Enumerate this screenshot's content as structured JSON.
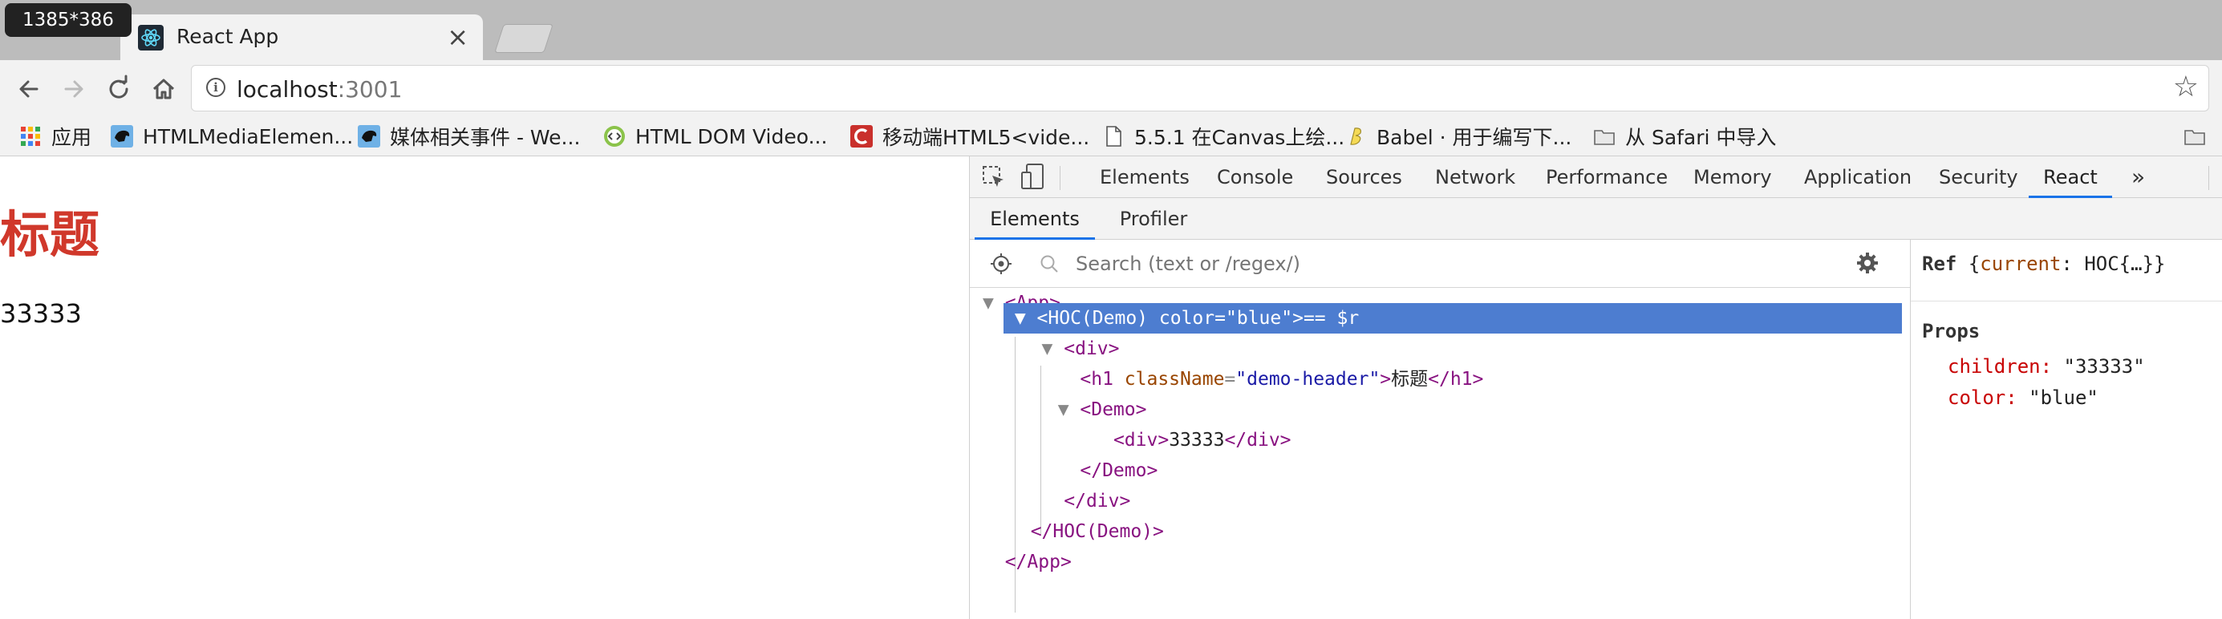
{
  "size_badge": "1385*386",
  "tab": {
    "title": "React App",
    "close": "×"
  },
  "address": {
    "host": "localhost",
    "port": ":3001"
  },
  "bookmarks": [
    {
      "label": "应用",
      "icon": "apps-grid-icon"
    },
    {
      "label": "HTMLMediaElemen...",
      "icon": "panther-icon"
    },
    {
      "label": "媒体相关事件 - We...",
      "icon": "panther-icon"
    },
    {
      "label": "HTML DOM Video...",
      "icon": "code-badge-icon"
    },
    {
      "label": "移动端HTML5<vide...",
      "icon": "c-logo-icon"
    },
    {
      "label": "5.5.1 在Canvas上绘...",
      "icon": "document-icon"
    },
    {
      "label": "Babel · 用于编写下...",
      "icon": "babel-icon"
    },
    {
      "label": "从 Safari 中导入",
      "icon": "folder-icon"
    }
  ],
  "page": {
    "heading": "标题",
    "text": "33333"
  },
  "devtools": {
    "tabs": [
      "Elements",
      "Console",
      "Sources",
      "Network",
      "Performance",
      "Memory",
      "Application",
      "Security",
      "React"
    ],
    "active_tab": "React",
    "more": "»",
    "subtabs": [
      "Elements",
      "Profiler"
    ],
    "search_placeholder": "Search (text or /regex/)",
    "tree": {
      "app_open": "<App>",
      "hoc_open": "<HOC(Demo)",
      "hoc_attr": "color",
      "hoc_val": "\"blue\"",
      "hoc_tail": ">== $r",
      "div_open": "<div>",
      "h1_open": "<h1",
      "h1_attr": "className",
      "h1_val": "\"demo-header\"",
      "h1_close_bracket": ">",
      "h1_text": "标题",
      "h1_close": "</h1>",
      "demo_open": "<Demo>",
      "inner_div_open": "<div>",
      "inner_div_text": "33333",
      "inner_div_close": "</div>",
      "demo_close": "</Demo>",
      "div_close": "</div>",
      "hoc_close": "</HOC(Demo)>",
      "app_close": "</App>"
    },
    "side": {
      "ref_label": "Ref",
      "ref_value_open": "{",
      "ref_key": "current",
      "ref_value": ": HOC{…}}",
      "props_heading": "Props",
      "props": [
        {
          "key": "children:",
          "value": "\"33333\""
        },
        {
          "key": "color:",
          "value": "\"blue\""
        }
      ]
    }
  },
  "colors": {
    "heading": "#d0382b",
    "selection": "#4d7dd0",
    "tag": "#881280",
    "attr": "#994500",
    "value": "#1a1aa6",
    "accent": "#1a73e8"
  }
}
